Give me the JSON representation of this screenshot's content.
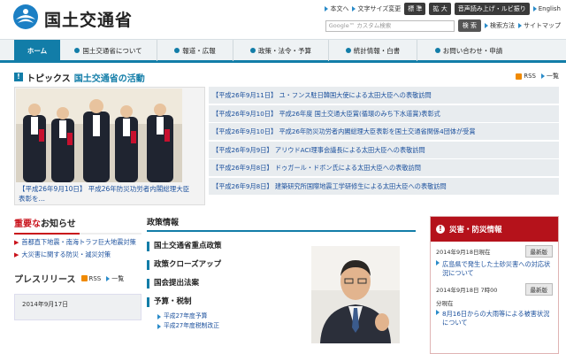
{
  "header": {
    "site_title": "国土交通省",
    "links": [
      "本文へ",
      "文字サイズ変更"
    ],
    "size_buttons": [
      "標 準",
      "拡 大"
    ],
    "voice_button": "音声読み上げ・ルビ振り",
    "english": "English",
    "search_placeholder": "Google™ カスタム検索",
    "search_button": "検 索",
    "search_help": "検索方法",
    "sitemap": "サイトマップ"
  },
  "nav": {
    "items": [
      "ホーム",
      "国土交通省について",
      "報道・広報",
      "政策・法令・予算",
      "統計情報・白書",
      "お問い合わせ・申請"
    ]
  },
  "topics": {
    "title": "トピックス",
    "subtitle": "国土交通省の活動",
    "rss": "RSS",
    "list_link": "一覧",
    "photo_caption": "【平成26年9月10日】 平成26年防災功労者内閣総理大臣表彰を…",
    "items": [
      "【平成26年9月11日】 ユ・フンス駐日韓国大使による太田大臣への表敬訪問",
      "【平成26年9月10日】 平成26年度 国土交通大臣賞(循環のみち下水道賞)表彰式",
      "【平成26年9月10日】 平成26年防災功労者内閣総理大臣表彰を国土交通省関係4団体が受賞",
      "【平成26年9月9日】 アリウドACI理事会議長による太田大臣への表敬訪問",
      "【平成26年9月8日】 ドゥガール・ドボン氏による太田大臣への表敬訪問",
      "【平成26年9月8日】 建築研究所国際地震工学研修生による太田大臣への表敬訪問"
    ]
  },
  "news": {
    "title_red": "重要な",
    "title_rest": "お知らせ",
    "items": [
      "首都直下地震・南海トラフ巨大地震対策",
      "大災害に関する防災・減災対策"
    ]
  },
  "press": {
    "title": "プレスリリース",
    "rss": "RSS",
    "list_link": "一覧",
    "date": "2014年9月17日"
  },
  "policy": {
    "title": "政策情報",
    "items": [
      "国土交通省重点政策",
      "政策クローズアップ",
      "国会提出法案",
      "予算・税制"
    ],
    "sub_links": [
      "平成27年度予算",
      "平成27年度税制改正"
    ]
  },
  "disaster": {
    "title": "災害・防災情報",
    "entries": [
      {
        "date": "2014年9月18日現在",
        "button": "最新版",
        "link": "広島県で発生した土砂災害への対応状況について"
      },
      {
        "date": "2014年9月18日 7時00",
        "button": "最新版",
        "link": ""
      },
      {
        "date": "分現在",
        "button": "",
        "link": "8月16日からの大雨等による被害状況について"
      }
    ]
  },
  "colors": {
    "accent": "#127da8",
    "alert": "#b5121b",
    "link": "#1a4f9c"
  }
}
